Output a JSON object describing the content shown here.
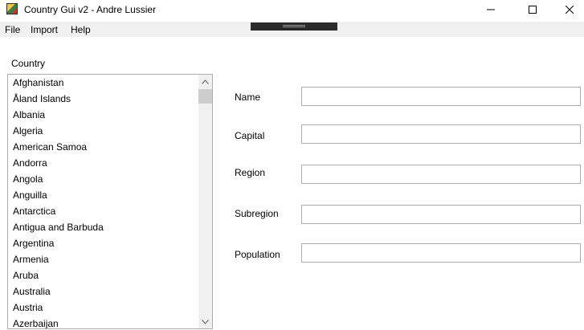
{
  "window": {
    "title": "Country Gui v2 - Andre Lussier",
    "app_icon": "globe-flag-icon",
    "controls": [
      "minimize-icon",
      "maximize-icon",
      "close-icon"
    ]
  },
  "menu": {
    "file": "File",
    "import": "Import",
    "help": "Help"
  },
  "country_list": {
    "label": "Country",
    "items": [
      "Afghanistan",
      "Åland Islands",
      "Albania",
      "Algeria",
      "American Samoa",
      "Andorra",
      "Angola",
      "Anguilla",
      "Antarctica",
      "Antigua and Barbuda",
      "Argentina",
      "Armenia",
      "Aruba",
      "Australia",
      "Austria",
      "Azerbaijan"
    ]
  },
  "fields": {
    "name": {
      "label": "Name",
      "value": ""
    },
    "capital": {
      "label": "Capital",
      "value": ""
    },
    "region": {
      "label": "Region",
      "value": ""
    },
    "subregion": {
      "label": "Subregion",
      "value": ""
    },
    "population": {
      "label": "Population",
      "value": ""
    }
  }
}
